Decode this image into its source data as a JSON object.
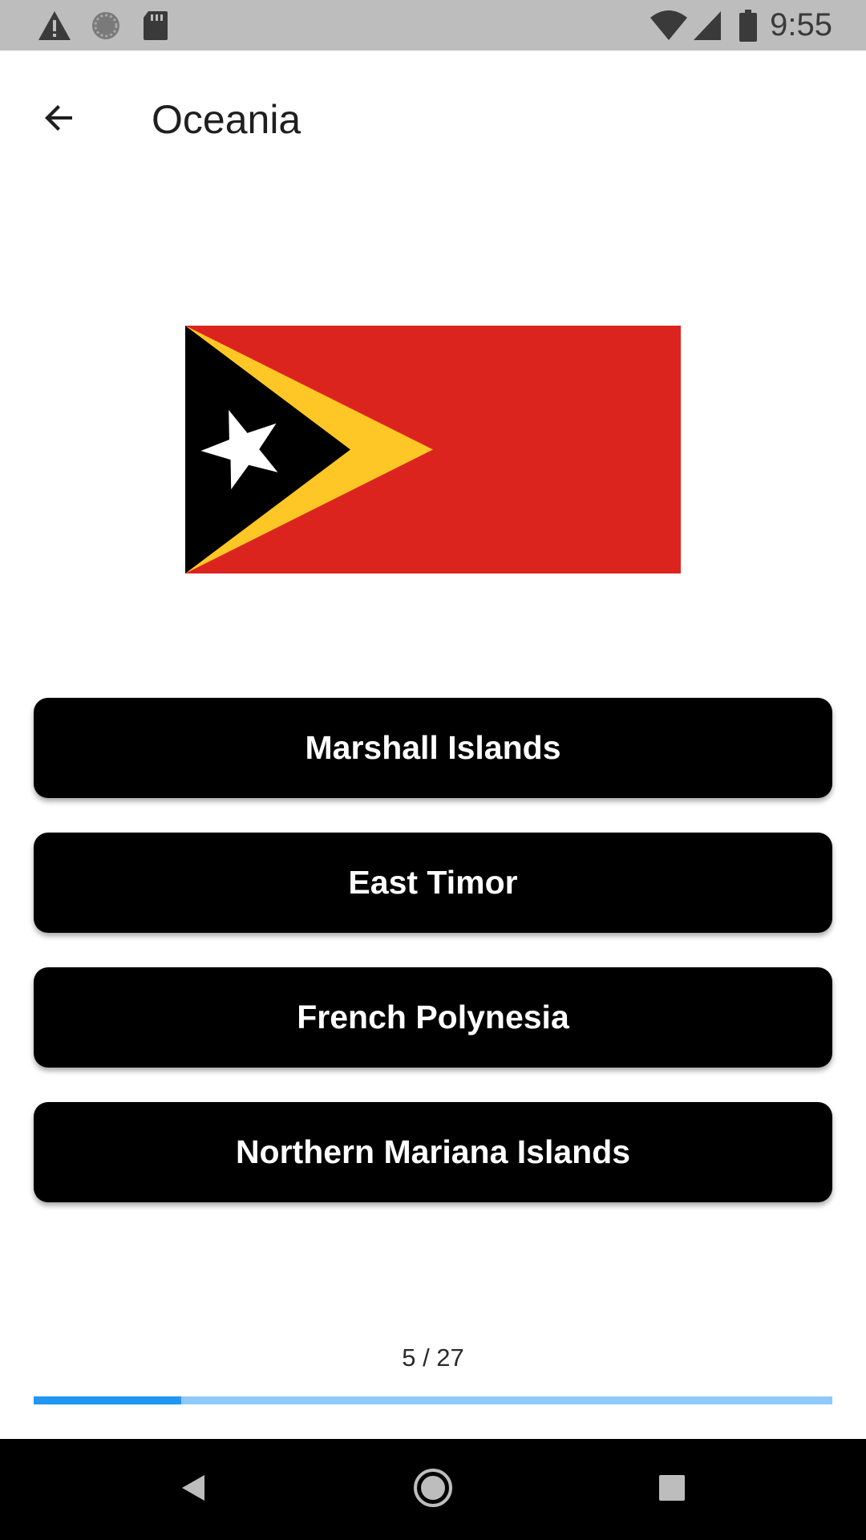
{
  "status_bar": {
    "time": "9:55",
    "icons": [
      "warning-icon",
      "sync-icon",
      "sd-card-icon",
      "wifi-icon",
      "signal-icon",
      "battery-icon"
    ]
  },
  "app_bar": {
    "back_icon": "arrow-back-icon",
    "title": "Oceania"
  },
  "flag": {
    "country_depicted": "East Timor",
    "colors": {
      "field": "#dc241f",
      "chevron": "#ffc726",
      "triangle": "#000000",
      "star": "#ffffff"
    }
  },
  "answers": [
    {
      "label": "Marshall Islands"
    },
    {
      "label": "East Timor"
    },
    {
      "label": "French Polynesia"
    },
    {
      "label": "Northern Mariana Islands"
    }
  ],
  "progress": {
    "label": "5 / 27",
    "current": 5,
    "total": 27,
    "fill_color": "#2196f3",
    "track_color": "#90caf9"
  },
  "nav_bar": {
    "icons": [
      "nav-back-icon",
      "nav-home-icon",
      "nav-recents-icon"
    ]
  }
}
